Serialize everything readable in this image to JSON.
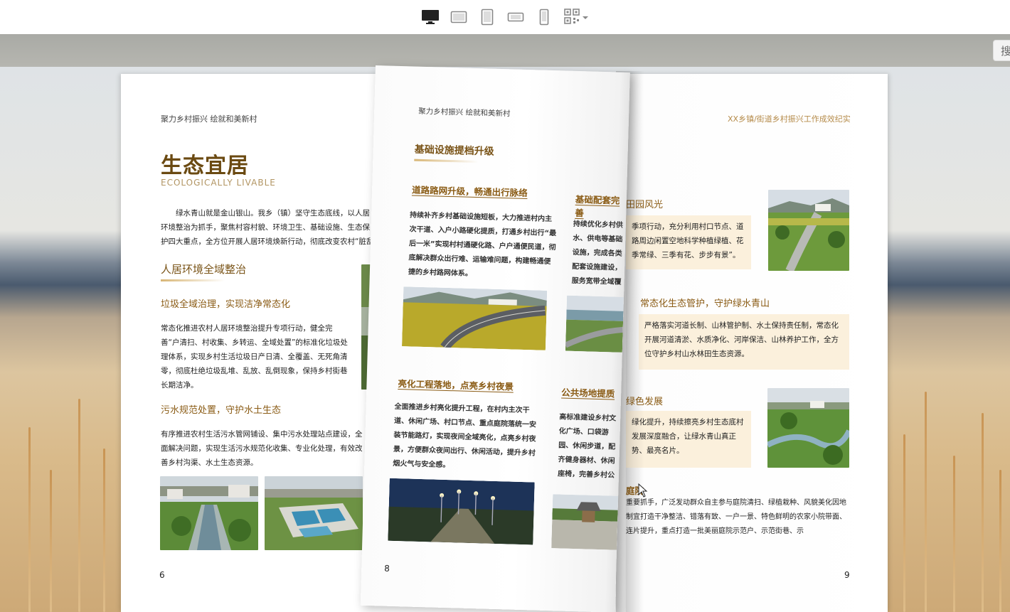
{
  "toolbar": {
    "icons": [
      "desktop-icon",
      "tablet-landscape-icon",
      "tablet-portrait-icon",
      "phone-landscape-icon",
      "phone-portrait-icon",
      "qr-code-icon"
    ],
    "dropdown": "chevron-down-icon"
  },
  "search": {
    "label": "搜"
  },
  "page_left": {
    "running_head": "聚力乡村振兴  绘就和美新村",
    "title": "生态宜居",
    "title_en": "ECOLOGICALLY LIVABLE",
    "intro": "绿水青山就是金山银山。我乡（镇）坚守生态底线，以人居环境整治为抓手，聚焦村容村貌、环境卫生、基础设施、生态保护四大重点，全方位开展人居环境焕新行动，彻底改变农村“脏乱差”旧面貌，打造宜居、宜业、宜游的美丽乡村。",
    "section": "人居环境全域整治",
    "sub1": "垃圾全域治理，实现洁净常态化",
    "p1": "常态化推进农村人居环境整治提升专项行动，健全完善“户清扫、村收集、乡转运、全域处置”的标准化垃圾处理体系，实现乡村生活垃圾日产日清、全覆盖、无死角清零，彻底杜绝垃圾乱堆、乱放、乱倒现象，保持乡村街巷长期洁净。",
    "sub2": "污水规范处置，守护水土生态",
    "p2": "有序推进农村生活污水管网铺设、集中污水处理站点建设，全面解决问题，实现生活污水规范化收集、专业化处理，有效改善乡村沟渠、水土生态资源。",
    "page_number": "6"
  },
  "page_flip": {
    "running_head": "聚力乡村振兴  绘就和美新村",
    "section": "基础设施提档升级",
    "sub1": "道路路网升级，畅通出行脉络",
    "p1": "持续补齐乡村基础设施短板，大力推进村内主次干道、入户小路硬化提质，打通乡村出行“最后一米”实现村村通硬化路、户户通便民道，彻底解决群众出行难、运输难问题，构建畅通便捷的乡村路网体系。",
    "sub2": "基础配套完善",
    "p2": "持续优化乡村供水、供电等基础设施，完成各类配套设施建设，服务宽带全域覆盖，满足农业生产、群众生活需求，夯实乡村",
    "sub3": "亮化工程落地，点亮乡村夜景",
    "p3": "全面推进乡村亮化提升工程，在村内主次干道、休闲广场、村口节点、重点庭院落统一安装节能路灯，实现夜间全域亮化，点亮乡村夜景，方便群众夜间出行、休闲活动，提升乡村烟火气与安全感。",
    "sub4": "公共场地提质",
    "p4": "高标准建设乡村文化广场、口袋游园、休闲步道，配齐健身器材、休闲座椅，完善乡村公共服务功能，提供便利度与居住舒适度",
    "page_number": "8"
  },
  "page_right": {
    "running_head": "XX乡镇/街道乡村振兴工作成效纪实",
    "sub1": "田园风光",
    "box1": "季项行动，充分利用村口节点、道路周边闲置空地科学种植绿植、花季常绿、三季有花、步步有景”。",
    "sub2": "常态化生态管护，守护绿水青山",
    "box2": "严格落实河道长制、山林管护制、水土保持责任制，常态化开展河道清淤、水质净化、河岸保洁、山林养护工作，全方位守护乡村山水林田生态资源。",
    "sub3": "绿色发展",
    "box3": "绿化提升，持续擦亮乡村生态底村发展深度融合，让绿水青山真正势、最亮名片。",
    "sub4": "庭院",
    "p4": "重要抓手，广泛发动群众自主参与庭院清扫、绿植栽种、风貌美化因地制宜打造干净整洁、错落有致、一户一景、特色鲜明的农家小院带面、连片提升，重点打造一批美丽庭院示范户、示范街巷、示",
    "page_number": "9"
  }
}
